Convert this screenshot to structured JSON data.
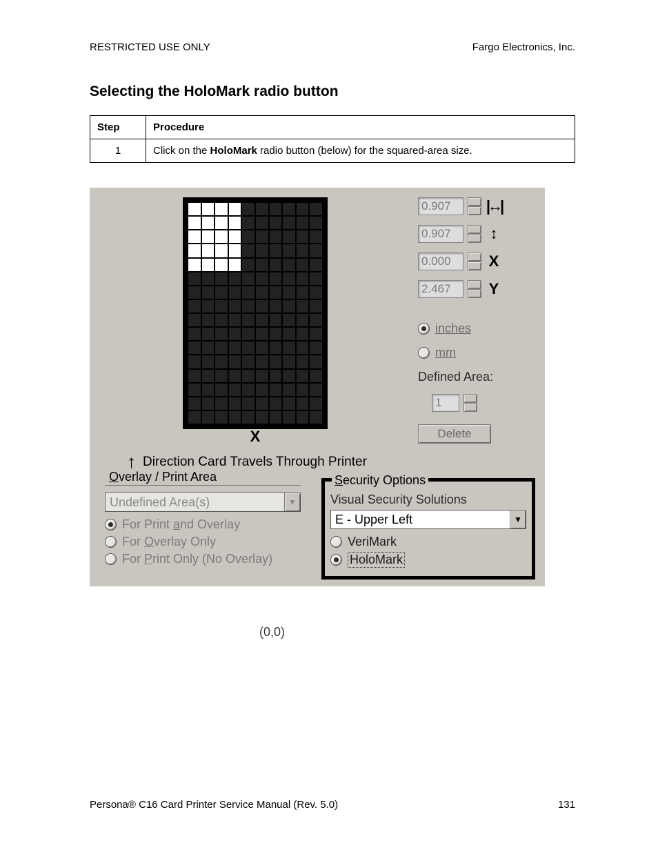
{
  "header": {
    "left": "RESTRICTED USE ONLY",
    "right": "Fargo Electronics, Inc."
  },
  "section_title": "Selecting the HoloMark radio button",
  "table": {
    "head_step": "Step",
    "head_proc": "Procedure",
    "row_num": "1",
    "row_text_a": "Click on the ",
    "row_text_bold": "HoloMark",
    "row_text_b": " radio button (below) for the squared-area size."
  },
  "fig": {
    "width_val": "0.907",
    "height_val": "0.907",
    "x_val": "0.000",
    "y_val": "2.467",
    "y_axis": "Y",
    "x_axis": "X",
    "origin": "(0,0)",
    "unit_inches": "inches",
    "unit_mm": "mm",
    "defined_area_label": "Defined Area:",
    "defined_area_val": "1",
    "delete_btn": "Delete",
    "direction": "Direction Card Travels Through Printer",
    "overlay_title_u": "O",
    "overlay_title_rest": "verlay / Print Area",
    "overlay_dd": "Undefined Area(s)",
    "ov_opt1_a": "For Print ",
    "ov_opt1_u": "a",
    "ov_opt1_b": "nd Overlay",
    "ov_opt2_a": "For ",
    "ov_opt2_u": "O",
    "ov_opt2_b": "verlay Only",
    "ov_opt3_a": "For ",
    "ov_opt3_u": "P",
    "ov_opt3_b": "rint Only (No Overlay)",
    "sec_title_u": "S",
    "sec_title_rest": "ecurity Options",
    "sec_sub": "Visual Security Solutions",
    "sec_dd": "E - Upper Left",
    "sec_opt1": "VeriMark",
    "sec_opt2": "HoloMark",
    "dim_w_icon": "↔",
    "dim_h_icon": "↕",
    "dim_x_icon": "X",
    "dim_y_icon": "Y"
  },
  "footer": {
    "left_a": "Persona",
    "left_reg": "®",
    "left_b": " C16 Card Printer Service Manual (Rev. 5.0)",
    "page": "131"
  }
}
